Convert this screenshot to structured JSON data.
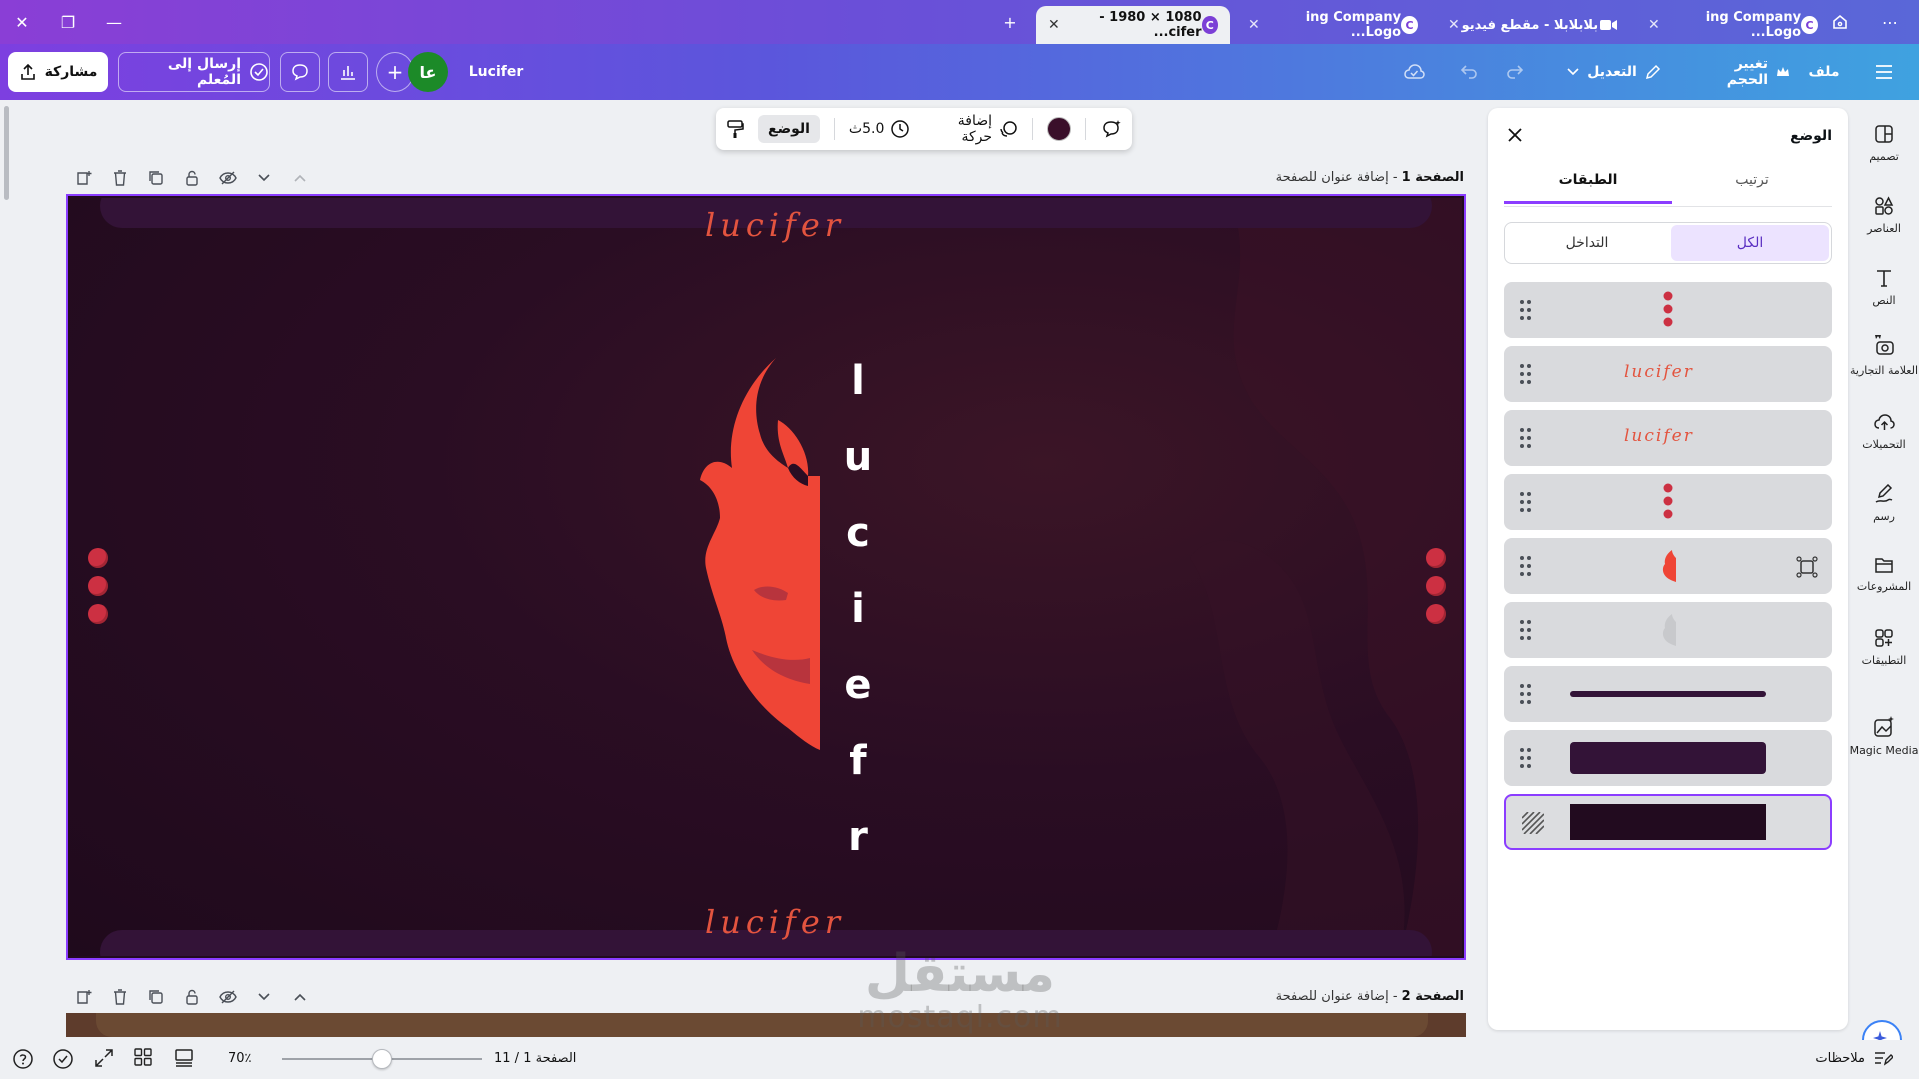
{
  "browser": {
    "tabs": [
      {
        "title": "1080 × 1980 - cifer...",
        "active": true
      },
      {
        "title": "ing Company Logo...",
        "active": false
      },
      {
        "title": "بلابلابلا - مقطع فيديو",
        "active": false
      },
      {
        "title": "ing Company Logo...",
        "active": false
      }
    ],
    "new_tab": "+",
    "more": "⋯",
    "window_close": "✕",
    "window_restore": "❐",
    "window_minimize": "—"
  },
  "header": {
    "menu_icon": "hamburger-icon",
    "file_label": "ملف",
    "resize_label": "تغيير الحجم",
    "edit_label": "التعديل",
    "title": "Lucifer",
    "avatar_initials": "عا",
    "send_teacher_label": "إرسال إلى المُعلم",
    "share_label": "مشاركة"
  },
  "toolbar": {
    "position_label": "الوضع",
    "duration": "5.0ث",
    "animate_label": "إضافة حركة",
    "color": "#3a0f2a"
  },
  "pages": [
    {
      "label": "الصفحة 1",
      "title_placeholder": "- إضافة عنوان للصفحة"
    },
    {
      "label": "الصفحة 2",
      "title_placeholder": "- إضافة عنوان للصفحة"
    }
  ],
  "design": {
    "small_text_top": "lucifer",
    "small_text_bottom": "lucifer",
    "vertical_letters": [
      "l",
      "u",
      "c",
      "i",
      "e",
      "f",
      "r"
    ],
    "bg_color": "#220b1f",
    "accent": "#e3543f",
    "dot_color": "#cc3042"
  },
  "panel": {
    "title": "الوضع",
    "tabs": [
      "ترتيب",
      "الطبقات"
    ],
    "active_tab": "الطبقات",
    "filters": [
      "الكل",
      "التداخل"
    ],
    "active_filter": "الكل",
    "layers": [
      {
        "type": "dots"
      },
      {
        "type": "text",
        "text": "lucifer"
      },
      {
        "type": "text",
        "text": "lucifer"
      },
      {
        "type": "dots"
      },
      {
        "type": "logo"
      },
      {
        "type": "logo-faded"
      },
      {
        "type": "line"
      },
      {
        "type": "rect"
      },
      {
        "type": "background"
      }
    ]
  },
  "rail": [
    {
      "label": "تصميم",
      "icon": "design-icon"
    },
    {
      "label": "العناصر",
      "icon": "elements-icon"
    },
    {
      "label": "النص",
      "icon": "text-icon"
    },
    {
      "label": "العلامة التجارية",
      "icon": "brand-icon"
    },
    {
      "label": "التحميلات",
      "icon": "upload-icon"
    },
    {
      "label": "رسم",
      "icon": "draw-icon"
    },
    {
      "label": "المشروعات",
      "icon": "folder-icon"
    },
    {
      "label": "التطبيقات",
      "icon": "apps-icon"
    },
    {
      "label": "Magic Media",
      "icon": "magic-media-icon"
    }
  ],
  "bottombar": {
    "notes_label": "ملاحظات",
    "page_indicator": "الصفحة 1 / 11",
    "zoom": "70٪",
    "zoom_value": 0.5
  },
  "watermark": {
    "arabic": "مستقل",
    "latin": "mostaql.com"
  }
}
